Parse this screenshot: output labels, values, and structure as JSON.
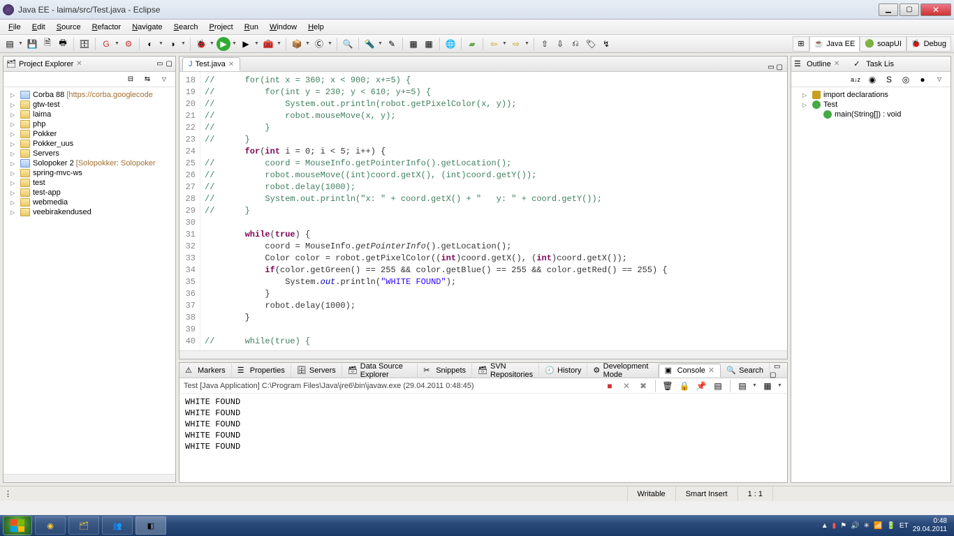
{
  "window": {
    "title": "Java EE - laima/src/Test.java - Eclipse"
  },
  "menu": [
    "File",
    "Edit",
    "Source",
    "Refactor",
    "Navigate",
    "Search",
    "Project",
    "Run",
    "Window",
    "Help"
  ],
  "perspectives": [
    {
      "label": "Java EE",
      "active": true
    },
    {
      "label": "soapUI",
      "active": false
    },
    {
      "label": "Debug",
      "active": false
    }
  ],
  "projectExplorer": {
    "title": "Project Explorer",
    "items": [
      {
        "label": "Corba 88",
        "deco": " [https://corba.googlecode",
        "proj": true
      },
      {
        "label": "gtw-test",
        "proj": false
      },
      {
        "label": "laima",
        "proj": false
      },
      {
        "label": "php",
        "proj": false
      },
      {
        "label": "Pokker",
        "proj": false
      },
      {
        "label": "Pokker_uus",
        "proj": false
      },
      {
        "label": "Servers",
        "proj": false
      },
      {
        "label": "Solopoker 2",
        "deco": " [Solopokker: Solopoker",
        "proj": true
      },
      {
        "label": "spring-mvc-ws",
        "proj": false
      },
      {
        "label": "test",
        "proj": false
      },
      {
        "label": "test-app",
        "proj": false
      },
      {
        "label": "webmedia",
        "proj": false
      },
      {
        "label": "veebirakendused",
        "proj": false
      }
    ]
  },
  "editor": {
    "tab": "Test.java",
    "startLine": 18,
    "lines": [
      {
        "n": 18,
        "c": true,
        "t": "//      for(int x = 360; x < 900; x+=5) {"
      },
      {
        "n": 19,
        "c": true,
        "t": "//          for(int y = 230; y < 610; y+=5) {"
      },
      {
        "n": 20,
        "c": true,
        "t": "//              System.out.println(robot.getPixelColor(x, y));"
      },
      {
        "n": 21,
        "c": true,
        "t": "//              robot.mouseMove(x, y);"
      },
      {
        "n": 22,
        "c": true,
        "t": "//          }"
      },
      {
        "n": 23,
        "c": true,
        "t": "//      }"
      },
      {
        "n": 24,
        "k": false,
        "html": "        <span class='kw'>for</span>(<span class='kw'>int</span> i = 0; i < 5; i++) {"
      },
      {
        "n": 25,
        "c": true,
        "t": "//          coord = MouseInfo.getPointerInfo().getLocation();"
      },
      {
        "n": 26,
        "c": true,
        "t": "//          robot.mouseMove((int)coord.getX(), (int)coord.getY());"
      },
      {
        "n": 27,
        "c": true,
        "t": "//          robot.delay(1000);"
      },
      {
        "n": 28,
        "c": true,
        "t": "//          System.out.println(\"x: \" + coord.getX() + \"   y: \" + coord.getY());"
      },
      {
        "n": 29,
        "c": true,
        "t": "//      }"
      },
      {
        "n": 30,
        "t": ""
      },
      {
        "n": 31,
        "html": "        <span class='kw'>while</span>(<span class='kw'>true</span>) {"
      },
      {
        "n": 32,
        "html": "            coord = MouseInfo.<span class='static-call'>getPointerInfo</span>().getLocation();"
      },
      {
        "n": 33,
        "html": "            Color color = robot.getPixelColor((<span class='kw'>int</span>)coord.getX(), (<span class='kw'>int</span>)coord.getX());"
      },
      {
        "n": 34,
        "html": "            <span class='kw'>if</span>(color.getGreen() == 255 && color.getBlue() == 255 && color.getRed() == 255) {"
      },
      {
        "n": 35,
        "html": "                System.<span class='fld-it'>out</span>.println(<span class='str'>\"WHITE FOUND\"</span>);"
      },
      {
        "n": 36,
        "t": "            }"
      },
      {
        "n": 37,
        "t": "            robot.delay(1000);"
      },
      {
        "n": 38,
        "t": "        }"
      },
      {
        "n": 39,
        "t": ""
      },
      {
        "n": 40,
        "c": true,
        "t": "//      while(true) {"
      }
    ]
  },
  "outline": {
    "title": "Outline",
    "task_title": "Task Lis",
    "items": [
      {
        "label": "import declarations",
        "icon": "pkg"
      },
      {
        "label": "Test",
        "icon": "green"
      },
      {
        "label": "main(String[]) : void",
        "icon": "green",
        "indent": true,
        "suffix_color": "#888"
      }
    ]
  },
  "bottomTabs": [
    "Markers",
    "Properties",
    "Servers",
    "Data Source Explorer",
    "Snippets",
    "SVN Repositories",
    "History",
    "Development Mode",
    "Console",
    "Search"
  ],
  "bottomActive": 8,
  "console": {
    "title": "Test [Java Application] C:\\Program Files\\Java\\jre6\\bin\\javaw.exe (29.04.2011 0:48:45)",
    "lines": [
      "WHITE FOUND",
      "WHITE FOUND",
      "WHITE FOUND",
      "WHITE FOUND",
      "WHITE FOUND"
    ]
  },
  "status": {
    "writable": "Writable",
    "insert": "Smart Insert",
    "pos": "1 : 1"
  },
  "taskbar": {
    "time": "0:48",
    "date": "29.04.2011"
  }
}
